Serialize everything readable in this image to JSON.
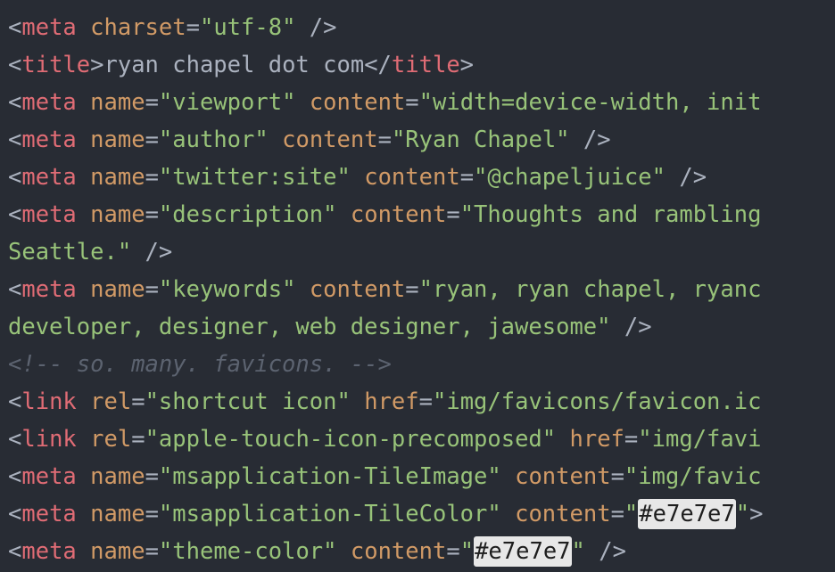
{
  "editor": {
    "background": "#282c34",
    "lines": [
      [
        [
          "p",
          "<"
        ],
        [
          "t",
          "meta"
        ],
        [
          "p",
          " "
        ],
        [
          "a",
          "charset"
        ],
        [
          "p",
          "="
        ],
        [
          "s",
          "\"utf-8\""
        ],
        [
          "p",
          " />"
        ]
      ],
      [
        [
          "p",
          "<"
        ],
        [
          "t",
          "title"
        ],
        [
          "p",
          ">"
        ],
        [
          "x",
          "ryan chapel dot com"
        ],
        [
          "p",
          "</"
        ],
        [
          "t",
          "title"
        ],
        [
          "p",
          ">"
        ]
      ],
      [
        [
          "p",
          "<"
        ],
        [
          "t",
          "meta"
        ],
        [
          "p",
          " "
        ],
        [
          "a",
          "name"
        ],
        [
          "p",
          "="
        ],
        [
          "s",
          "\"viewport\""
        ],
        [
          "p",
          " "
        ],
        [
          "a",
          "content"
        ],
        [
          "p",
          "="
        ],
        [
          "s",
          "\"width=device-width, init"
        ]
      ],
      [
        [
          "p",
          "<"
        ],
        [
          "t",
          "meta"
        ],
        [
          "p",
          " "
        ],
        [
          "a",
          "name"
        ],
        [
          "p",
          "="
        ],
        [
          "s",
          "\"author\""
        ],
        [
          "p",
          " "
        ],
        [
          "a",
          "content"
        ],
        [
          "p",
          "="
        ],
        [
          "s",
          "\"Ryan Chapel\""
        ],
        [
          "p",
          " />"
        ]
      ],
      [
        [
          "p",
          "<"
        ],
        [
          "t",
          "meta"
        ],
        [
          "p",
          " "
        ],
        [
          "a",
          "name"
        ],
        [
          "p",
          "="
        ],
        [
          "s",
          "\"twitter:site\""
        ],
        [
          "p",
          " "
        ],
        [
          "a",
          "content"
        ],
        [
          "p",
          "="
        ],
        [
          "s",
          "\"@chapeljuice\""
        ],
        [
          "p",
          " />"
        ]
      ],
      [
        [
          "p",
          "<"
        ],
        [
          "t",
          "meta"
        ],
        [
          "p",
          " "
        ],
        [
          "a",
          "name"
        ],
        [
          "p",
          "="
        ],
        [
          "s",
          "\"description\""
        ],
        [
          "p",
          " "
        ],
        [
          "a",
          "content"
        ],
        [
          "p",
          "="
        ],
        [
          "s",
          "\"Thoughts and rambling"
        ]
      ],
      [
        [
          "s",
          "Seattle.\""
        ],
        [
          "p",
          " />"
        ]
      ],
      [
        [
          "p",
          "<"
        ],
        [
          "t",
          "meta"
        ],
        [
          "p",
          " "
        ],
        [
          "a",
          "name"
        ],
        [
          "p",
          "="
        ],
        [
          "s",
          "\"keywords\""
        ],
        [
          "p",
          " "
        ],
        [
          "a",
          "content"
        ],
        [
          "p",
          "="
        ],
        [
          "s",
          "\"ryan, ryan chapel, ryanc"
        ]
      ],
      [
        [
          "s",
          "developer, designer, web designer, jawesome\""
        ],
        [
          "p",
          " />"
        ]
      ],
      [
        [
          "c",
          "<!-- so. many. favicons. -->"
        ]
      ],
      [
        [
          "p",
          "<"
        ],
        [
          "t",
          "link"
        ],
        [
          "p",
          " "
        ],
        [
          "a",
          "rel"
        ],
        [
          "p",
          "="
        ],
        [
          "s",
          "\"shortcut icon\""
        ],
        [
          "p",
          " "
        ],
        [
          "a",
          "href"
        ],
        [
          "p",
          "="
        ],
        [
          "s",
          "\"img/favicons/favicon.ic"
        ]
      ],
      [
        [
          "p",
          "<"
        ],
        [
          "t",
          "link"
        ],
        [
          "p",
          " "
        ],
        [
          "a",
          "rel"
        ],
        [
          "p",
          "="
        ],
        [
          "s",
          "\"apple-touch-icon-precomposed\""
        ],
        [
          "p",
          " "
        ],
        [
          "a",
          "href"
        ],
        [
          "p",
          "="
        ],
        [
          "s",
          "\"img/favi"
        ]
      ],
      [
        [
          "p",
          "<"
        ],
        [
          "t",
          "meta"
        ],
        [
          "p",
          " "
        ],
        [
          "a",
          "name"
        ],
        [
          "p",
          "="
        ],
        [
          "s",
          "\"msapplication-TileImage\""
        ],
        [
          "p",
          " "
        ],
        [
          "a",
          "content"
        ],
        [
          "p",
          "="
        ],
        [
          "s",
          "\"img/favic"
        ]
      ],
      [
        [
          "p",
          "<"
        ],
        [
          "t",
          "meta"
        ],
        [
          "p",
          " "
        ],
        [
          "a",
          "name"
        ],
        [
          "p",
          "="
        ],
        [
          "s",
          "\"msapplication-TileColor\""
        ],
        [
          "p",
          " "
        ],
        [
          "a",
          "content"
        ],
        [
          "p",
          "="
        ],
        [
          "s",
          "\""
        ],
        [
          "k",
          "#e7e7e7"
        ],
        [
          "s",
          "\""
        ],
        [
          "p",
          ">"
        ]
      ],
      [
        [
          "p",
          "<"
        ],
        [
          "t",
          "meta"
        ],
        [
          "p",
          " "
        ],
        [
          "a",
          "name"
        ],
        [
          "p",
          "="
        ],
        [
          "s",
          "\"theme-color\""
        ],
        [
          "p",
          " "
        ],
        [
          "a",
          "content"
        ],
        [
          "p",
          "="
        ],
        [
          "s",
          "\""
        ],
        [
          "k",
          "#e7e7e7"
        ],
        [
          "s",
          "\""
        ],
        [
          "p",
          " />"
        ]
      ]
    ]
  }
}
